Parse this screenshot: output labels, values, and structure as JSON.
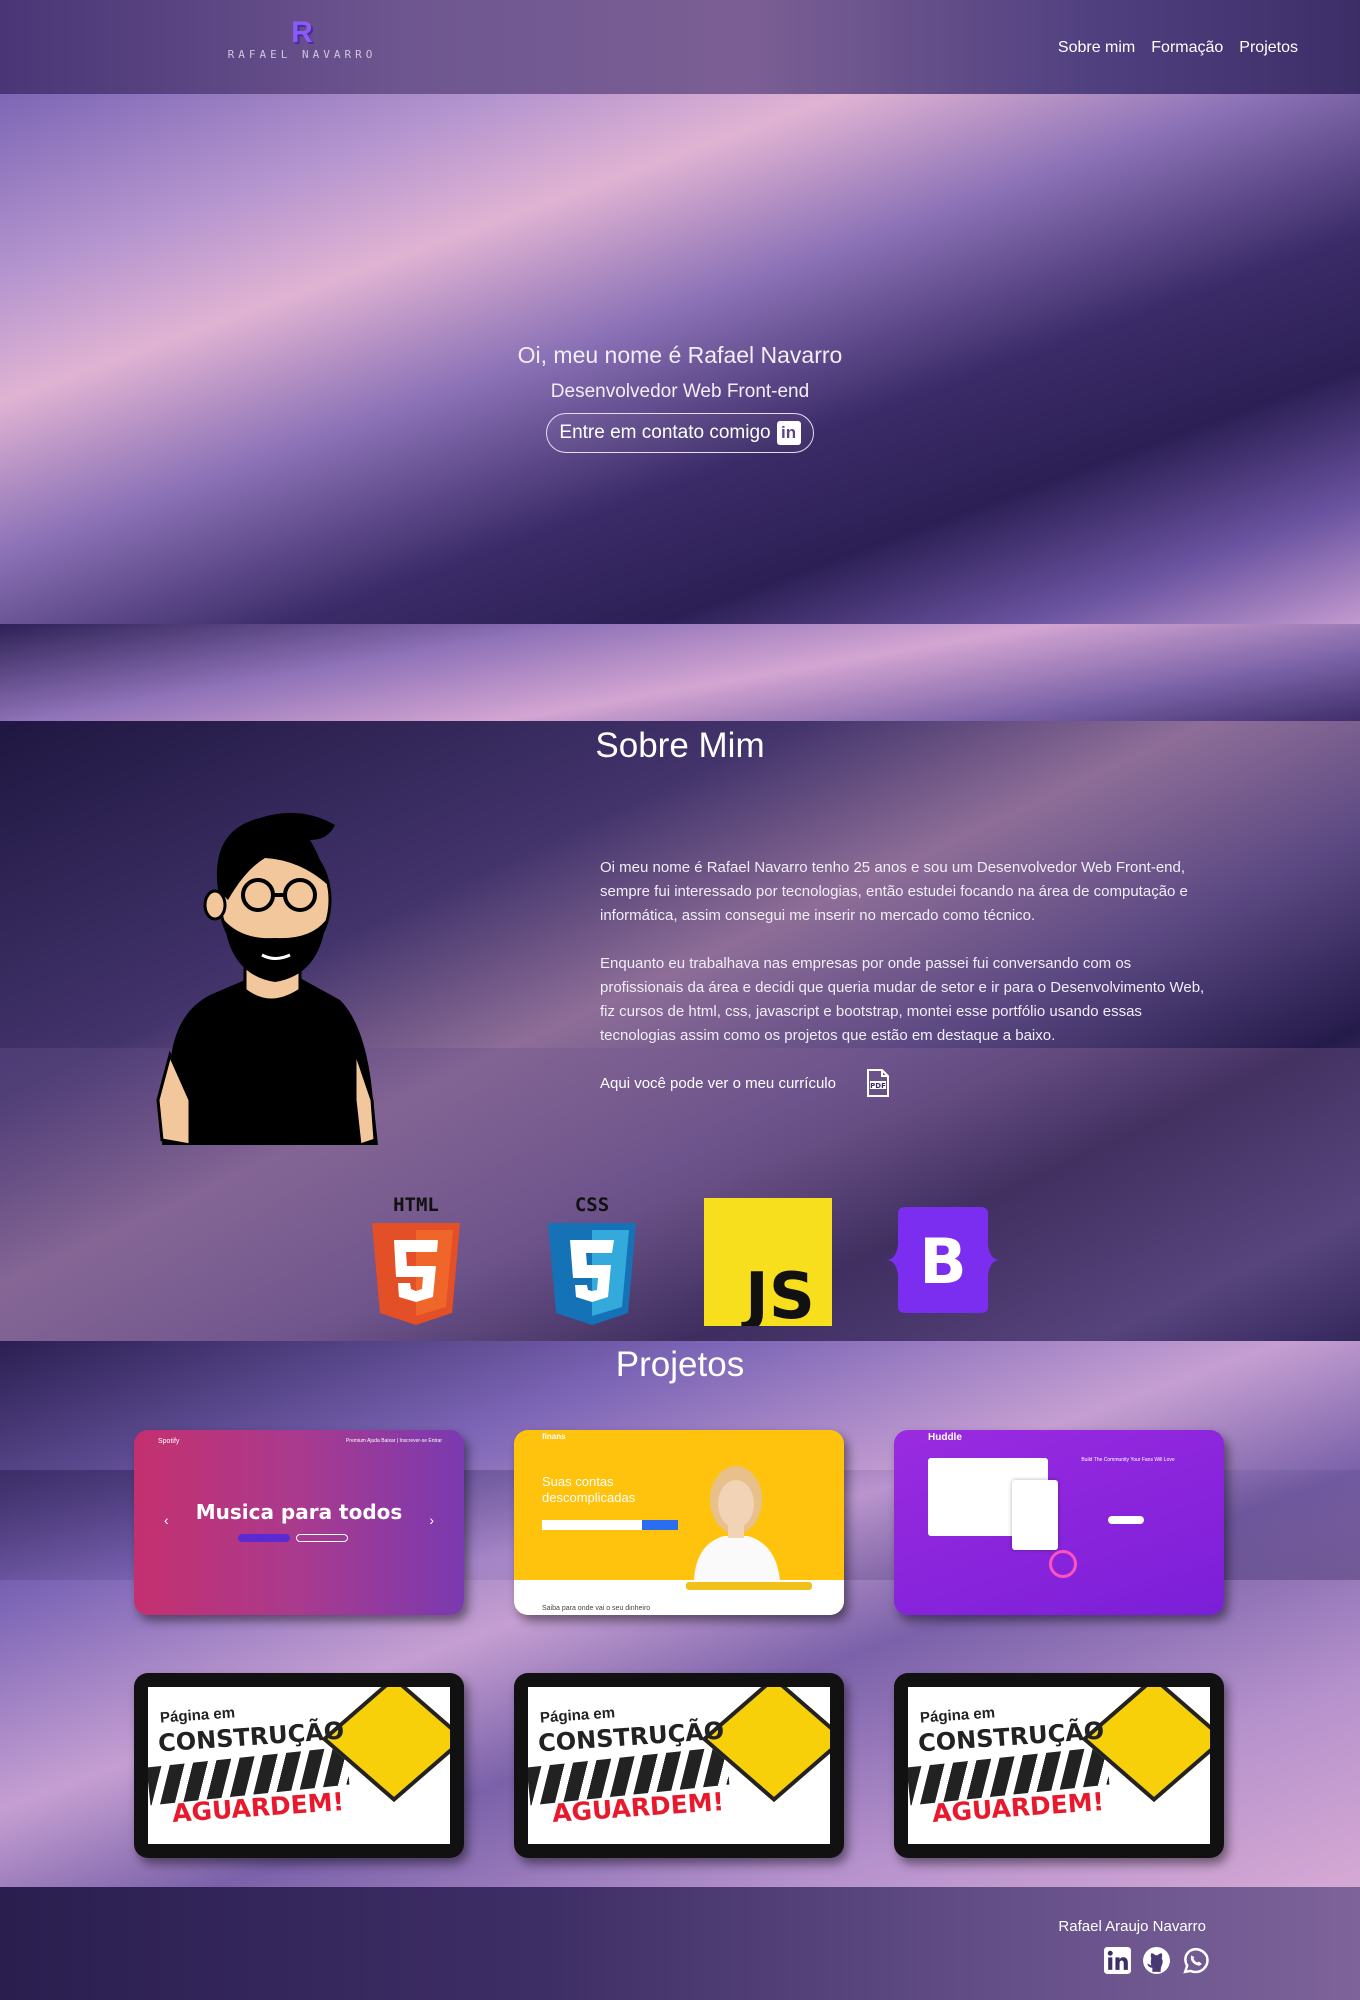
{
  "header": {
    "logo_mark": "R",
    "logo_text": "RAFAEL NAVARRO",
    "nav": [
      "Sobre mim",
      "Formação",
      "Projetos"
    ]
  },
  "hero": {
    "greeting": "Oi, meu nome é Rafael Navarro",
    "role": "Desenvolvedor Web Front-end",
    "contact_label": "Entre em contato comigo",
    "contact_icon": "linkedin-icon"
  },
  "about": {
    "title": "Sobre Mim",
    "paragraphs": [
      "Oi meu nome é Rafael Navarro tenho 25 anos e sou um Desenvolvedor Web Front-end, sempre fui interessado por tecnologias, então estudei focando na área de computação e informática, assim consegui me inserir no mercado como técnico.",
      "Enquanto eu trabalhava nas empresas por onde passei fui conversando com os profissionais da área e decidi que queria mudar de setor e ir para o Desenvolvimento Web, fiz cursos de html, css, javascript e bootstrap, montei esse portfólio usando essas tecnologias assim como os projetos que estão em destaque a baixo."
    ],
    "cv_label": "Aqui você pode ver o meu currículo",
    "cv_icon": "pdf-icon",
    "tech": {
      "html": "HTML",
      "css": "CSS",
      "js": "JS",
      "bootstrap": "B"
    }
  },
  "projects": {
    "title": "Projetos",
    "spotify": {
      "brand": "Spotify",
      "nav": "Premium  Ajuda  Baixar  |  Inscrever-se  Entrar",
      "headline": "Musica para todos"
    },
    "finans": {
      "brand": "finans",
      "headline": "Suas contas descomplicadas",
      "footer": "Saiba para onde vai o seu dinheiro"
    },
    "huddle": {
      "brand": "Huddle",
      "headline": "Build The Community Your Fans Will Love"
    },
    "wip": {
      "line1": "Página em",
      "line2": "CONSTRUÇÃO",
      "line3": "AGUARDEM!"
    }
  },
  "footer": {
    "name": "Rafael Araujo Navarro",
    "icons": [
      "linkedin-icon",
      "github-icon",
      "whatsapp-icon"
    ]
  },
  "colors": {
    "accent": "#8a5cf6",
    "bootstrap": "#7952b3",
    "js": "#f7df1e",
    "html": "#e34f26",
    "css": "#1572b6"
  }
}
